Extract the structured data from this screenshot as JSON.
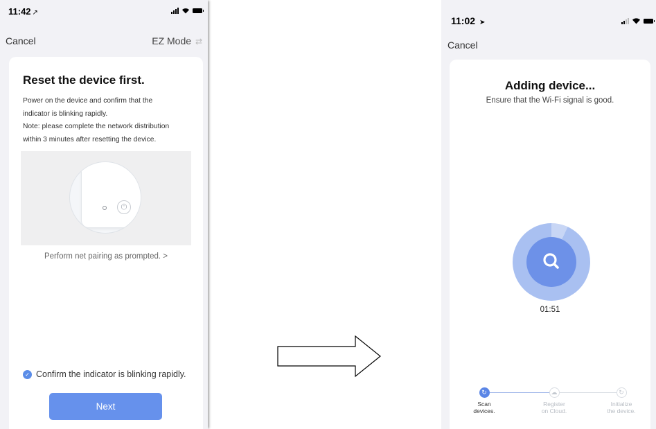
{
  "left_screen": {
    "status_time": "11:42",
    "status_location_glyph": "↗",
    "nav": {
      "cancel": "Cancel",
      "mode": "EZ Mode",
      "mode_icon": "⇄"
    },
    "title": "Reset the device first.",
    "description": [
      "Power on the device and confirm that the",
      "indicator is blinking rapidly.",
      "Note: please complete the network distribution",
      "within 3 minutes after resetting the device."
    ],
    "illustration_icon": "power-icon",
    "pairing_link": "Perform net pairing as prompted. >",
    "confirm_label": "Confirm the indicator is blinking rapidly.",
    "confirm_checked": true,
    "next_button": "Next"
  },
  "right_screen": {
    "status_time": "11:02",
    "status_location_glyph": "➤",
    "nav": {
      "cancel": "Cancel"
    },
    "title": "Adding device...",
    "subtitle": "Ensure that the Wi-Fi signal is good.",
    "timer": "01:51",
    "steps": [
      {
        "label_line1": "Scan",
        "label_line2": "devices.",
        "state": "active"
      },
      {
        "label_line1": "Register",
        "label_line2": "on Cloud.",
        "state": "pending"
      },
      {
        "label_line1": "Initialize",
        "label_line2": "the device.",
        "state": "pending"
      }
    ]
  },
  "colors": {
    "accent": "#6691ec",
    "radar_outer": "#a9c0f1",
    "radar_inner": "#6d91e8",
    "background": "#f2f2f6"
  }
}
